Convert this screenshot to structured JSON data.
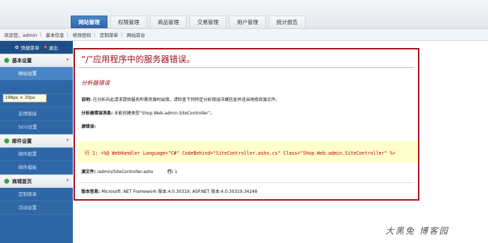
{
  "header": {
    "tabs": [
      {
        "label": "网站管理",
        "active": true
      },
      {
        "label": "权限管理",
        "active": false
      },
      {
        "label": "商品管理",
        "active": false
      },
      {
        "label": "交易管理",
        "active": false
      },
      {
        "label": "用户管理",
        "active": false
      },
      {
        "label": "统计报告",
        "active": false
      }
    ]
  },
  "subbar": {
    "welcome": "欢迎您，admin",
    "links": [
      "基本信息",
      "修改密码",
      "定制菜单",
      "网站前台"
    ]
  },
  "sidebar": {
    "quick_menu": "快捷菜单",
    "exit": "退出",
    "sections": [
      {
        "title": "基本设置",
        "items": [
          "网站设置",
          "公司信息设置",
          "友情链接",
          "SEO设置"
        ]
      },
      {
        "title": "邮件设置",
        "items": [
          "邮件配置",
          "邮件模板"
        ]
      },
      {
        "title": "商城首页",
        "items": [
          "定制菜单",
          "活动设置"
        ]
      }
    ],
    "tooltip": "198px × 30px"
  },
  "error": {
    "title": "“/”应用程序中的服务器错误。",
    "subtitle": "分析器错误",
    "desc_label": "说明:",
    "desc": "在分析向此请求提供服务所需资源时出错。请检查下列特定分析错误详细信息并适当地修改源文件。",
    "msg_label": "分析器错误消息:",
    "msg": "未能创建类型“Shop.Web.admin.SiteController”。",
    "source_label": "源错误:",
    "code_line": "行 1:  <%@ WebHandler Language=\"C#\" CodeBehind=\"SiteController.ashx.cs\" Class=\"Shop.Web.admin.SiteController\" %>",
    "file_label": "源文件:",
    "file": "/admin/SiteController.ashx",
    "line_label": "行:",
    "line": "1",
    "version_label": "版本信息:",
    "version": "Microsoft .NET Framework 版本:4.0.30319; ASP.NET 版本:4.0.30319.34248"
  },
  "watermark": "大黑兔  博客园"
}
